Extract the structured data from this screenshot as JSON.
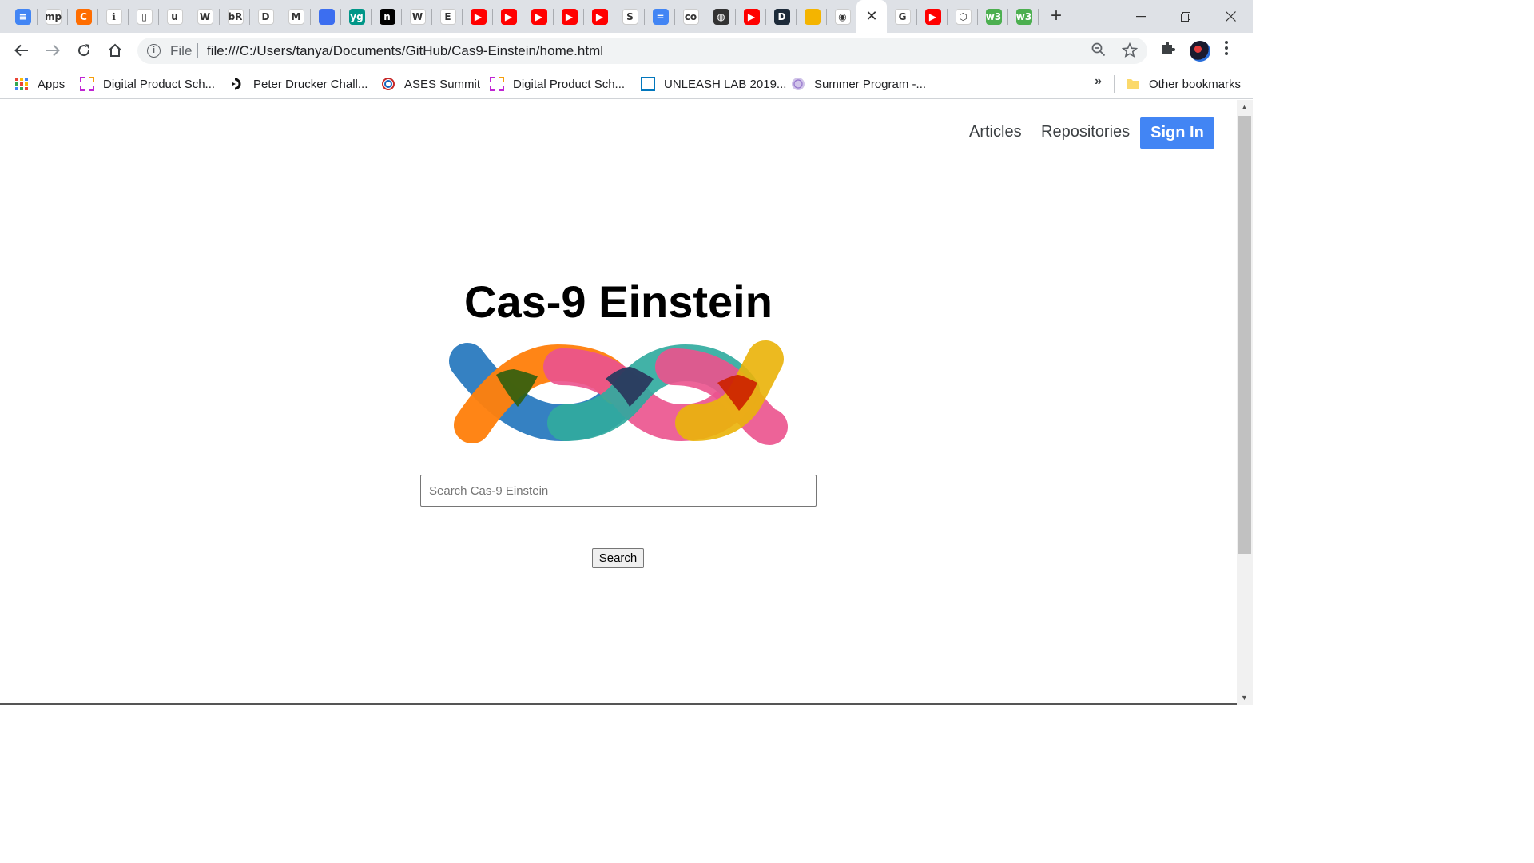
{
  "browser": {
    "tabs_favicons": [
      {
        "name": "google-docs-icon",
        "bg": "#4285f4",
        "glyph": "≡"
      },
      {
        "name": "mp-icon",
        "bg": "#ffffff",
        "glyph": "mp"
      },
      {
        "name": "c-icon",
        "bg": "#ff6d00",
        "glyph": "C"
      },
      {
        "name": "info-blue-icon",
        "bg": "#ffffff",
        "glyph": "ℹ"
      },
      {
        "name": "green-doc-icon",
        "bg": "#ffffff",
        "glyph": "▯"
      },
      {
        "name": "u-red-icon",
        "bg": "#ffffff",
        "glyph": "u"
      },
      {
        "name": "wikipedia-icon",
        "bg": "#ffffff",
        "glyph": "W"
      },
      {
        "name": "br-icon",
        "bg": "#ffffff",
        "glyph": "bR"
      },
      {
        "name": "d-icon",
        "bg": "#ffffff",
        "glyph": "D"
      },
      {
        "name": "gmail-icon",
        "bg": "#ffffff",
        "glyph": "M"
      },
      {
        "name": "blue-d-icon",
        "bg": "#3c6ef0",
        "glyph": ""
      },
      {
        "name": "yg-icon",
        "bg": "#009688",
        "glyph": "yg"
      },
      {
        "name": "n-icon",
        "bg": "#000000",
        "glyph": "n"
      },
      {
        "name": "wikipedia-icon-2",
        "bg": "#ffffff",
        "glyph": "W"
      },
      {
        "name": "e-icon",
        "bg": "#ffffff",
        "glyph": "E"
      },
      {
        "name": "youtube-icon-1",
        "bg": "#ff0000",
        "glyph": "▶"
      },
      {
        "name": "youtube-icon-2",
        "bg": "#ff0000",
        "glyph": "▶"
      },
      {
        "name": "youtube-icon-3",
        "bg": "#ff0000",
        "glyph": "▶"
      },
      {
        "name": "youtube-icon-4",
        "bg": "#ff0000",
        "glyph": "▶"
      },
      {
        "name": "youtube-icon-5",
        "bg": "#ff0000",
        "glyph": "▶"
      },
      {
        "name": "s-icon",
        "bg": "#ffffff",
        "glyph": "S"
      },
      {
        "name": "chat-icon",
        "bg": "#4285f4",
        "glyph": "="
      },
      {
        "name": "co-icon",
        "bg": "#ffffff",
        "glyph": "co"
      },
      {
        "name": "globe-icon",
        "bg": "#333333",
        "glyph": "◍"
      },
      {
        "name": "youtube-icon-6",
        "bg": "#ff0000",
        "glyph": "▶"
      },
      {
        "name": "d-dark-icon",
        "bg": "#1d2b3a",
        "glyph": "D"
      },
      {
        "name": "slides-icon",
        "bg": "#f4b400",
        "glyph": ""
      },
      {
        "name": "github-icon",
        "bg": "#ffffff",
        "glyph": "◉"
      }
    ],
    "tabs_favicons_after": [
      {
        "name": "google-icon",
        "bg": "#ffffff",
        "glyph": "G"
      },
      {
        "name": "youtube-icon-7",
        "bg": "#ff0000",
        "glyph": "▶"
      },
      {
        "name": "codepen-icon",
        "bg": "#ffffff",
        "glyph": "⬡"
      },
      {
        "name": "w3-icon-1",
        "bg": "#4caf50",
        "glyph": "w3"
      },
      {
        "name": "w3-icon-2",
        "bg": "#4caf50",
        "glyph": "w3"
      }
    ],
    "active_tab_close": "✕",
    "new_tab": "+",
    "url_scheme_label": "File",
    "url": "file:///C:/Users/tanya/Documents/GitHub/Cas9-Einstein/home.html",
    "bookmarks": [
      {
        "label": "Apps",
        "icon": "apps-grid-icon"
      },
      {
        "label": "Digital Product Sch...",
        "icon": "bracket-icon"
      },
      {
        "label": "Peter Drucker Chall...",
        "icon": "drucker-icon"
      },
      {
        "label": "ASES Summit",
        "icon": "ases-icon"
      },
      {
        "label": "Digital Product Sch...",
        "icon": "bracket-icon"
      },
      {
        "label": "UNLEASH LAB 2019...",
        "icon": "unleash-icon"
      },
      {
        "label": "Summer Program -...",
        "icon": "seal-icon"
      }
    ],
    "bookmarks_more": "»",
    "other_bookmarks": "Other bookmarks"
  },
  "page": {
    "nav": {
      "articles": "Articles",
      "repositories": "Repositories",
      "sign_in": "Sign In"
    },
    "title": "Cas-9 Einstein",
    "search": {
      "placeholder": "Search Cas-9 Einstein",
      "value": "",
      "button": "Search"
    }
  },
  "colors": {
    "sign_in_bg": "#4285f4",
    "logo_blue": "#2b7bbf",
    "logo_orange": "#ff7a00",
    "logo_dark_green": "#2f5e0e",
    "logo_pink": "#ea4c89",
    "logo_navy": "#2a3a5e",
    "logo_teal": "#26a69a",
    "logo_yellow": "#e9b000",
    "logo_red": "#cc2200"
  }
}
